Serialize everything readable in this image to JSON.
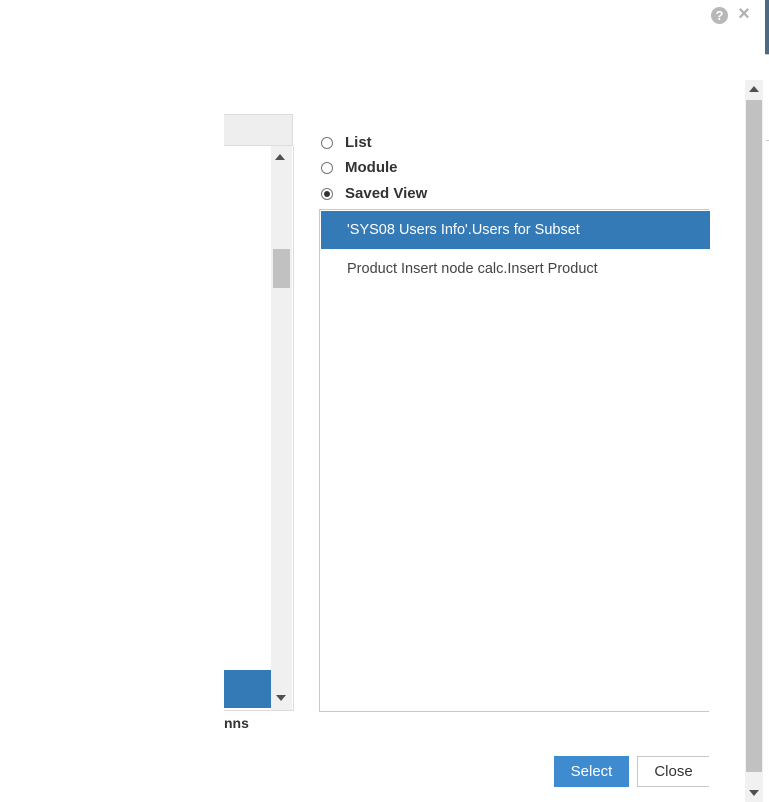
{
  "dialog": {
    "help_glyph": "?",
    "close_glyph": "×"
  },
  "left_panel": {
    "partial_label": "nns"
  },
  "source_options": [
    {
      "label": "List",
      "checked": false
    },
    {
      "label": "Module",
      "checked": false
    },
    {
      "label": "Saved View",
      "checked": true
    }
  ],
  "saved_views": [
    {
      "label": "'SYS08 Users Info'.Users for Subset",
      "selected": true
    },
    {
      "label": "Product Insert node calc.Insert Product",
      "selected": false
    }
  ],
  "buttons": {
    "select_label": "Select",
    "close_label": "Close"
  },
  "colors": {
    "accent": "#337ab7",
    "select_button": "#3f8bd0"
  }
}
